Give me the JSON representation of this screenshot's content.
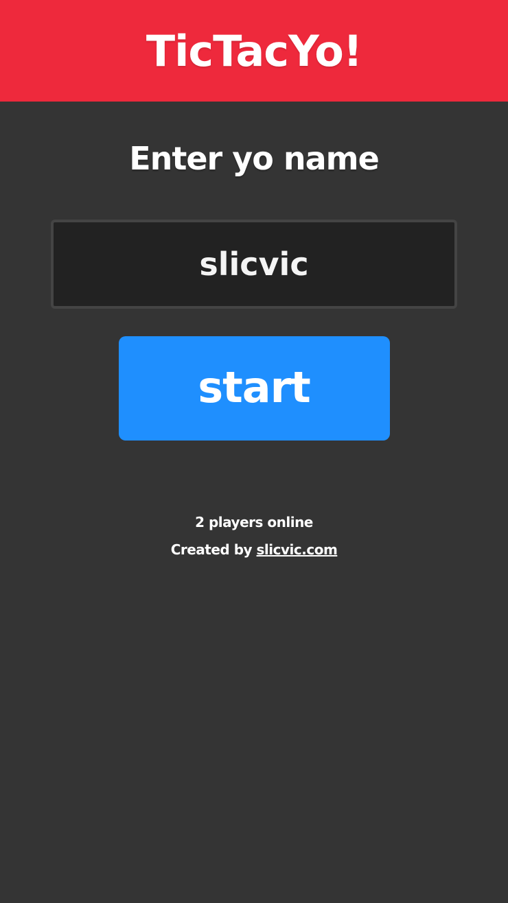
{
  "header": {
    "title": "TicTacYo!"
  },
  "main": {
    "prompt": "Enter yo name",
    "name_input": {
      "value": "slicvic",
      "placeholder": ""
    },
    "start_label": "start"
  },
  "footer": {
    "players_online": "2 players online",
    "created_by_text": "Created by ",
    "credit_link": "slicvic.com"
  },
  "colors": {
    "header_background": "#ee293c",
    "page_background": "#343434",
    "input_background": "#222222",
    "input_border": "#444444",
    "button_background": "#1f8ffe",
    "text": "#ffffff"
  }
}
